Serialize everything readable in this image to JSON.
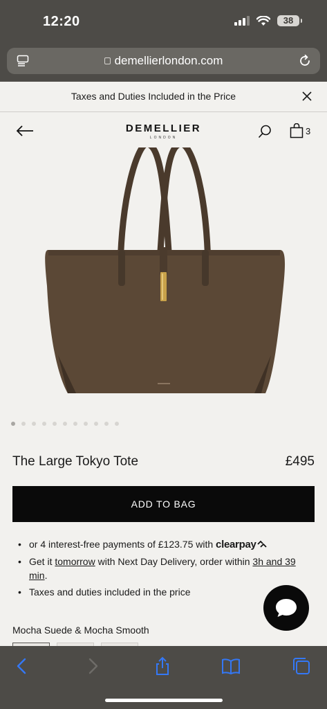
{
  "status_bar": {
    "time": "12:20",
    "battery": "38",
    "icons": [
      "signal-icon",
      "wifi-icon",
      "battery-icon"
    ]
  },
  "browser": {
    "url": "demellierlondon.com",
    "icons": [
      "tabs-icon",
      "lock-icon",
      "reload-icon"
    ]
  },
  "banner": {
    "text": "Taxes and Duties Included in the Price",
    "close_icon": "close-icon"
  },
  "header": {
    "logo": "DEMELLIER",
    "logo_sub": "LONDON",
    "cart_count": "3",
    "icons": [
      "back-arrow-icon",
      "search-icon",
      "bag-icon"
    ]
  },
  "gallery": {
    "slide_count": 11,
    "active_index": 0
  },
  "product": {
    "name": "The Large Tokyo Tote",
    "price": "£495",
    "add_to_bag": "ADD TO BAG",
    "bullets": {
      "payments_prefix": "or 4 interest-free payments of £123.75 with",
      "payments_brand": "clearpay",
      "delivery_prefix": "Get it",
      "delivery_day": "tomorrow",
      "delivery_mid": "with Next Day Delivery, order within",
      "delivery_time": "3h and 39 min",
      "delivery_end": ".",
      "taxes": "Taxes and duties included in the price"
    },
    "colour": "Mocha Suede & Mocha Smooth"
  },
  "colors": {
    "chrome": "#4d4b47",
    "page_bg": "#f2f1ee",
    "button": "#0a0a0a",
    "ios_blue": "#3478f6",
    "bag_suede": "#5b4836"
  },
  "toolbar": {
    "icons": [
      "back-icon",
      "forward-icon",
      "share-icon",
      "bookmarks-icon",
      "tabs-overview-icon"
    ]
  }
}
